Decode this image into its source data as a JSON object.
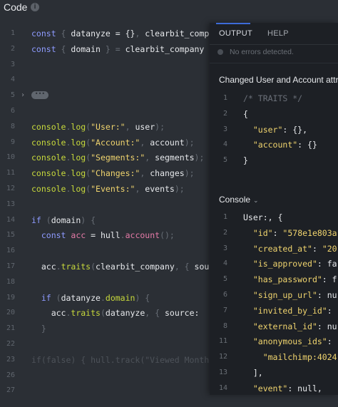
{
  "header": {
    "title": "Code",
    "info_icon": "info-icon"
  },
  "editor": {
    "lines": [
      {
        "n": "1",
        "tokens": [
          [
            "const ",
            "kw"
          ],
          [
            "{ ",
            "punc"
          ],
          [
            "datanyze",
            "var"
          ],
          [
            " = ",
            "var"
          ],
          [
            "{}",
            "var"
          ],
          [
            ", ",
            "punc"
          ],
          [
            "clearbit_company",
            "var"
          ]
        ]
      },
      {
        "n": "2",
        "tokens": [
          [
            "const ",
            "kw"
          ],
          [
            "{ ",
            "punc"
          ],
          [
            "domain",
            "var"
          ],
          [
            " } = ",
            "punc"
          ],
          [
            "clearbit_company",
            "var"
          ]
        ]
      },
      {
        "n": "3",
        "tokens": []
      },
      {
        "n": "4",
        "tokens": []
      },
      {
        "n": "5",
        "tokens": [],
        "fold": true
      },
      {
        "n": "6",
        "tokens": []
      },
      {
        "n": "8",
        "tokens": [
          [
            "console",
            "fn"
          ],
          [
            ".",
            "punc"
          ],
          [
            "log",
            "fn"
          ],
          [
            "(",
            "punc"
          ],
          [
            "\"User:\"",
            "str"
          ],
          [
            ", ",
            "punc"
          ],
          [
            "user",
            "var"
          ],
          [
            ");",
            "punc"
          ]
        ]
      },
      {
        "n": "9",
        "tokens": [
          [
            "console",
            "fn"
          ],
          [
            ".",
            "punc"
          ],
          [
            "log",
            "fn"
          ],
          [
            "(",
            "punc"
          ],
          [
            "\"Account:\"",
            "str"
          ],
          [
            ", ",
            "punc"
          ],
          [
            "account",
            "var"
          ],
          [
            ");",
            "punc"
          ]
        ]
      },
      {
        "n": "10",
        "tokens": [
          [
            "console",
            "fn"
          ],
          [
            ".",
            "punc"
          ],
          [
            "log",
            "fn"
          ],
          [
            "(",
            "punc"
          ],
          [
            "\"Segments:\"",
            "str"
          ],
          [
            ", ",
            "punc"
          ],
          [
            "segments",
            "var"
          ],
          [
            ");",
            "punc"
          ]
        ]
      },
      {
        "n": "11",
        "tokens": [
          [
            "console",
            "fn"
          ],
          [
            ".",
            "punc"
          ],
          [
            "log",
            "fn"
          ],
          [
            "(",
            "punc"
          ],
          [
            "\"Changes:\"",
            "str"
          ],
          [
            ", ",
            "punc"
          ],
          [
            "changes",
            "var"
          ],
          [
            ");",
            "punc"
          ]
        ]
      },
      {
        "n": "12",
        "tokens": [
          [
            "console",
            "fn"
          ],
          [
            ".",
            "punc"
          ],
          [
            "log",
            "fn"
          ],
          [
            "(",
            "punc"
          ],
          [
            "\"Events:\"",
            "str"
          ],
          [
            ", ",
            "punc"
          ],
          [
            "events",
            "var"
          ],
          [
            ");",
            "punc"
          ]
        ]
      },
      {
        "n": "13",
        "tokens": []
      },
      {
        "n": "14",
        "tokens": [
          [
            "if ",
            "kw"
          ],
          [
            "(",
            "punc"
          ],
          [
            "domain",
            "var"
          ],
          [
            ") {",
            "punc"
          ]
        ]
      },
      {
        "n": "15",
        "tokens": [
          [
            "  const ",
            "kw"
          ],
          [
            "acc",
            "prop"
          ],
          [
            " = ",
            "var"
          ],
          [
            "hull",
            "var"
          ],
          [
            ".",
            "punc"
          ],
          [
            "account",
            "prop"
          ],
          [
            "();",
            "punc"
          ]
        ]
      },
      {
        "n": "16",
        "tokens": []
      },
      {
        "n": "17",
        "tokens": [
          [
            "  acc",
            "var"
          ],
          [
            ".",
            "punc"
          ],
          [
            "traits",
            "fn"
          ],
          [
            "(",
            "punc"
          ],
          [
            "clearbit_company",
            "var"
          ],
          [
            ", { ",
            "punc"
          ],
          [
            "sou",
            "var"
          ]
        ]
      },
      {
        "n": "18",
        "tokens": []
      },
      {
        "n": "19",
        "tokens": [
          [
            "  if ",
            "kw"
          ],
          [
            "(",
            "punc"
          ],
          [
            "datanyze",
            "var"
          ],
          [
            ".",
            "punc"
          ],
          [
            "domain",
            "fn"
          ],
          [
            ") {",
            "punc"
          ]
        ]
      },
      {
        "n": "20",
        "tokens": [
          [
            "    acc",
            "var"
          ],
          [
            ".",
            "punc"
          ],
          [
            "traits",
            "fn"
          ],
          [
            "(",
            "punc"
          ],
          [
            "datanyze",
            "var"
          ],
          [
            ", { ",
            "punc"
          ],
          [
            "source: ",
            "var"
          ]
        ]
      },
      {
        "n": "21",
        "tokens": [
          [
            "  }",
            "punc"
          ]
        ]
      },
      {
        "n": "22",
        "tokens": []
      },
      {
        "n": "23",
        "tokens": [
          [
            "if(false) { hull.track(\"Viewed Month",
            "dim"
          ]
        ]
      },
      {
        "n": "26",
        "tokens": []
      },
      {
        "n": "27",
        "tokens": []
      }
    ]
  },
  "panel": {
    "tabs": [
      "OUTPUT",
      "HELP"
    ],
    "status_text": "No errors detected.",
    "changed_title": "Changed User and Account attri",
    "changed_lines": [
      {
        "n": "1",
        "tokens": [
          [
            "/* TRAITS */",
            "comment"
          ]
        ]
      },
      {
        "n": "2",
        "tokens": [
          [
            "{",
            "val"
          ]
        ]
      },
      {
        "n": "3",
        "tokens": [
          [
            "  ",
            "val"
          ],
          [
            "\"user\"",
            "key"
          ],
          [
            ": {},",
            "val"
          ]
        ]
      },
      {
        "n": "4",
        "tokens": [
          [
            "  ",
            "val"
          ],
          [
            "\"account\"",
            "key"
          ],
          [
            ": {}",
            "val"
          ]
        ]
      },
      {
        "n": "5",
        "tokens": [
          [
            "}",
            "val"
          ]
        ]
      }
    ],
    "console_title": "Console",
    "console_chevron": "chevron-down-icon",
    "console_lines": [
      {
        "n": "1",
        "tokens": [
          [
            "User:, {",
            "val"
          ]
        ]
      },
      {
        "n": "2",
        "tokens": [
          [
            "  ",
            "val"
          ],
          [
            "\"id\"",
            "key"
          ],
          [
            ": ",
            "val"
          ],
          [
            "\"578e1e803a",
            "key"
          ]
        ]
      },
      {
        "n": "3",
        "tokens": [
          [
            "  ",
            "val"
          ],
          [
            "\"created_at\"",
            "key"
          ],
          [
            ": ",
            "val"
          ],
          [
            "\"20",
            "key"
          ]
        ]
      },
      {
        "n": "4",
        "tokens": [
          [
            "  ",
            "val"
          ],
          [
            "\"is_approved\"",
            "key"
          ],
          [
            ": fa",
            "val"
          ]
        ]
      },
      {
        "n": "5",
        "tokens": [
          [
            "  ",
            "val"
          ],
          [
            "\"has_password\"",
            "key"
          ],
          [
            ": f",
            "val"
          ]
        ]
      },
      {
        "n": "6",
        "tokens": [
          [
            "  ",
            "val"
          ],
          [
            "\"sign_up_url\"",
            "key"
          ],
          [
            ": nu",
            "val"
          ]
        ]
      },
      {
        "n": "7",
        "tokens": [
          [
            "  ",
            "val"
          ],
          [
            "\"invited_by_id\"",
            "key"
          ],
          [
            ":",
            "val"
          ]
        ]
      },
      {
        "n": "8",
        "tokens": [
          [
            "  ",
            "val"
          ],
          [
            "\"external_id\"",
            "key"
          ],
          [
            ": nu",
            "val"
          ]
        ]
      },
      {
        "n": "11",
        "tokens": [
          [
            "  ",
            "val"
          ],
          [
            "\"anonymous_ids\"",
            "key"
          ],
          [
            ":",
            "val"
          ]
        ]
      },
      {
        "n": "12",
        "tokens": [
          [
            "    ",
            "val"
          ],
          [
            "\"mailchimp:4024",
            "key"
          ]
        ]
      },
      {
        "n": "13",
        "tokens": [
          [
            "  ],",
            "val"
          ]
        ]
      },
      {
        "n": "14",
        "tokens": [
          [
            "  ",
            "val"
          ],
          [
            "\"event\"",
            "key"
          ],
          [
            ": null,",
            "val"
          ]
        ]
      }
    ]
  }
}
